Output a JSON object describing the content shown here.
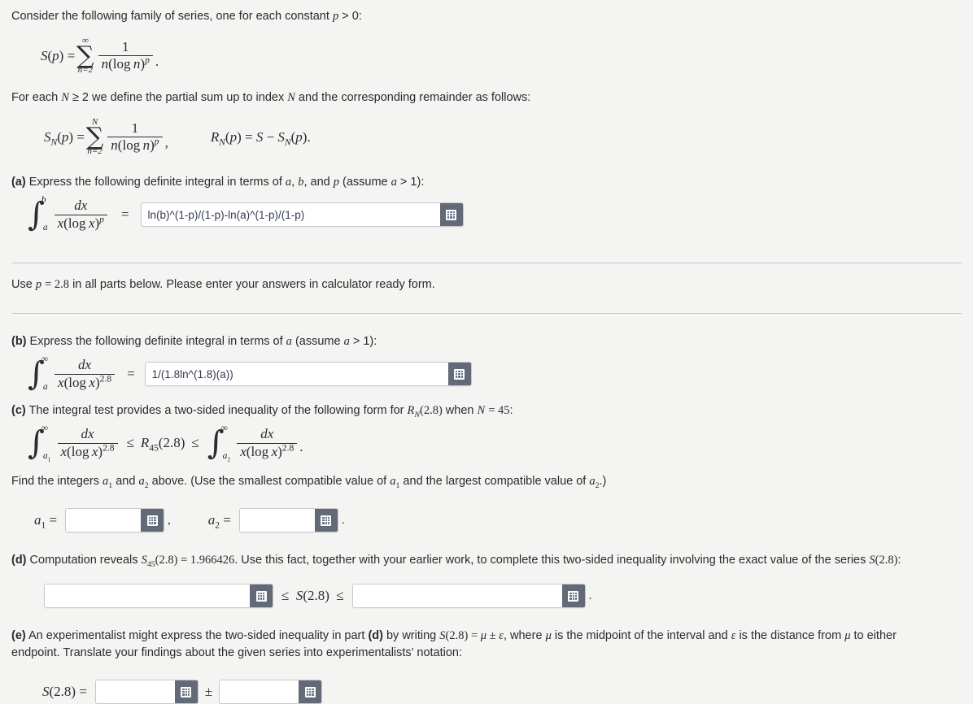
{
  "intro": {
    "line1_a": "Consider the following family of series, one for each constant ",
    "line1_p": "p",
    "line1_b": " > 0:",
    "eq1_lhs": "S(p) =",
    "eq1_sum_top": "∞",
    "eq1_sum_bot": "n=2",
    "eq1_num": "1",
    "eq1_den": "n(log n)",
    "eq1_den_exp": "p",
    "eq1_period": ".",
    "line2": "For each N ≥ 2 we define the partial sum up to index N and the corresponding remainder as follows:",
    "eq2_lhs": "S",
    "eq2_lhs_sub": "N",
    "eq2_lhs_rest": "(p) =",
    "eq2_sum_top": "N",
    "eq2_sum_bot": "n=2",
    "eq2_num": "1",
    "eq2_den": "n(log n)",
    "eq2_den_exp": "p",
    "eq2_comma": ",",
    "eq2_right": "R",
    "eq2_right_sub": "N",
    "eq2_right_rest": "(p) = S − S",
    "eq2_right_sub2": "N",
    "eq2_right_end": "(p)."
  },
  "parts": {
    "a": {
      "label": "(a)",
      "prompt": " Express the following definite integral in terms of a, b, and p (assume a > 1):",
      "int_upper": "b",
      "int_lower": "a",
      "num": "dx",
      "den": "x(log x)",
      "den_exp": "p",
      "equals": "=",
      "answer_value": "ln(b)^(1-p)/(1-p)-ln(a)^(1-p)/(1-p)",
      "answer_placeholder": "",
      "keypad_icon": "calculator-keypad-icon"
    },
    "note": {
      "text_a": "Use ",
      "text_p": "p = 2.8",
      "text_b": " in all parts below. Please enter your answers in calculator ready form."
    },
    "b": {
      "label": "(b)",
      "prompt": " Express the following definite integral in terms of a (assume a > 1):",
      "int_upper": "∞",
      "int_lower": "a",
      "num": "dx",
      "den": "x(log x)",
      "den_exp": "2.8",
      "equals": "=",
      "answer_value": "1/(1.8ln^(1.8)(a))",
      "answer_placeholder": "",
      "keypad_icon": "calculator-keypad-icon"
    },
    "c": {
      "label": "(c)",
      "prompt_1": " The integral test provides a two-sided inequality of the following form for ",
      "prompt_R": "R",
      "prompt_R_sub": "N",
      "prompt_R_rest": "(2.8)",
      "prompt_2": " when ",
      "prompt_N": "N = 45",
      "prompt_3": ":",
      "ineq_left_upper": "∞",
      "ineq_left_lower": "a",
      "ineq_left_lower_sub": "1",
      "ineq_num": "dx",
      "ineq_den": "x(log x)",
      "ineq_den_exp": "2.8",
      "ineq_le1": "≤",
      "ineq_mid": "R",
      "ineq_mid_sub": "45",
      "ineq_mid_rest": "(2.8)",
      "ineq_le2": "≤",
      "ineq_right_upper": "∞",
      "ineq_right_lower": "a",
      "ineq_right_lower_sub": "2",
      "ineq_period": ".",
      "find_text": "Find the integers a₁ and a₂ above. (Use the smallest compatible value of a₁ and the largest compatible value of a₂.)",
      "a1_label": "a",
      "a1_label_sub": "1",
      "a1_equals": "=",
      "a1_value": "",
      "a1_placeholder": "",
      "comma": ",",
      "a2_label": "a",
      "a2_label_sub": "2",
      "a2_equals": "=",
      "a2_value": "",
      "a2_placeholder": "",
      "period": ".",
      "keypad_icon": "calculator-keypad-icon"
    },
    "d": {
      "label": "(d)",
      "prompt_1": " Computation reveals ",
      "prompt_S": "S",
      "prompt_S_sub": "45",
      "prompt_S_rest": "(2.8) = 1.966426",
      "prompt_2": ". Use this fact, together with your earlier work, to complete this two-sided inequality involving the exact value of the series ",
      "prompt_S2": "S(2.8)",
      "prompt_3": ":",
      "lower_value": "",
      "lower_placeholder": "",
      "le1": "≤",
      "middle": "S(2.8)",
      "le2": "≤",
      "upper_value": "",
      "upper_placeholder": "",
      "period": ".",
      "keypad_icon": "calculator-keypad-icon"
    },
    "e": {
      "label": "(e)",
      "prompt_1": " An experimentalist might express the two-sided inequality in part ",
      "prompt_d": "(d)",
      "prompt_2": " by writing ",
      "prompt_eq": "S(2.8) = μ ± ε",
      "prompt_3": ", where μ is the midpoint of the interval and ε is the distance from μ to either",
      "prompt_line2": "endpoint. Translate your findings about the given series into experimentalists' notation:",
      "s_label": "S(2.8)",
      "s_equals": "=",
      "mu_value": "",
      "mu_placeholder": "",
      "pm": "±",
      "eps_value": "",
      "eps_placeholder": "",
      "keypad_icon": "calculator-keypad-icon"
    }
  },
  "colors": {
    "page_bg": "#f4f4f3",
    "text": "#2b2b2b",
    "input_text": "#333b52",
    "keypad_button": "#626a77",
    "rule": "#c6c6c6",
    "input_border": "#c9c9c9"
  }
}
